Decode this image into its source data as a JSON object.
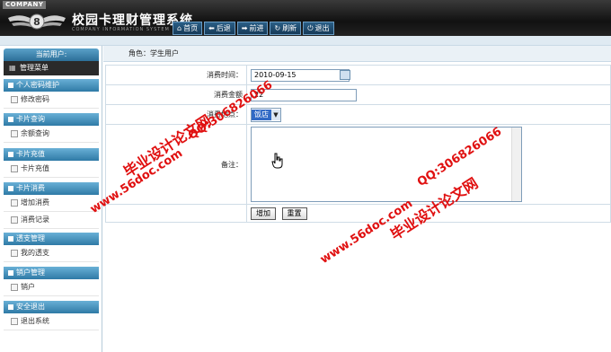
{
  "header": {
    "company_label": "COMPANY",
    "app_title": "校园卡理财管理系统",
    "app_subtitle": "COMPANY INFORMATION SYSTEM",
    "nav": [
      {
        "label": "首页",
        "icon": "home-icon"
      },
      {
        "label": "后退",
        "icon": "arrow-left-icon"
      },
      {
        "label": "前进",
        "icon": "arrow-right-icon"
      },
      {
        "label": "刷新",
        "icon": "refresh-icon"
      },
      {
        "label": "退出",
        "icon": "power-icon"
      }
    ]
  },
  "sidebar": {
    "current_user_label": "当前用户:",
    "menu_label": "管理菜单",
    "groups": [
      {
        "title": "个人密码维护",
        "items": [
          "修改密码"
        ]
      },
      {
        "title": "卡片查询",
        "items": [
          "余额查询"
        ]
      },
      {
        "title": "卡片充值",
        "items": [
          "卡片充值"
        ]
      },
      {
        "title": "卡片消费",
        "items": [
          "增加消费",
          "消费记录"
        ]
      },
      {
        "title": "透支管理",
        "items": [
          "我的透支"
        ]
      },
      {
        "title": "销户管理",
        "items": [
          "销户"
        ]
      },
      {
        "title": "安全退出",
        "items": [
          "退出系统"
        ]
      }
    ]
  },
  "role_bar": "角色：学生用户",
  "form": {
    "time_label": "消费时间：",
    "time_value": "2010-09-15",
    "amount_label": "消费金额",
    "amount_value": "22",
    "place_label": "消费地点：",
    "place_value": "饭店",
    "note_label": "备注：",
    "note_value": "",
    "submit_label": "增加",
    "reset_label": "重置"
  },
  "watermarks": [
    "毕业设计论文网",
    "www.56doc.com",
    "QQ:306826066",
    "www.56doc.com",
    "QQ:306826066",
    "毕业设计论文网"
  ],
  "colors": {
    "accent": "#2f7aa6",
    "header_bg": "#1a1a1a",
    "watermark": "#e01010"
  }
}
